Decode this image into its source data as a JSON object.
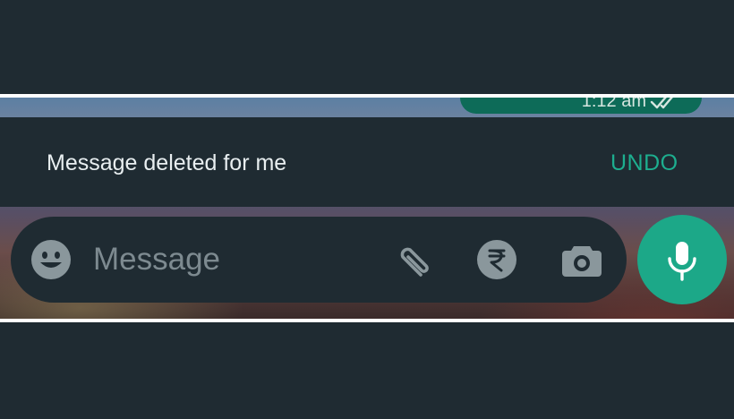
{
  "bubble": {
    "time": "1:12 am",
    "status_icon": "double-check-icon"
  },
  "snackbar": {
    "text": "Message deleted for me",
    "action_label": "UNDO"
  },
  "composer": {
    "placeholder": "Message",
    "icons": [
      "emoji-icon",
      "attach-paperclip-icon",
      "rupee-payment-icon",
      "camera-icon"
    ]
  },
  "mic": {
    "icon": "microphone-icon"
  },
  "colors": {
    "background": "#1f2b32",
    "accent": "#1ca888",
    "undo": "#1dae8f",
    "bubble": "#0d6b58",
    "icon": "#8a979c"
  }
}
